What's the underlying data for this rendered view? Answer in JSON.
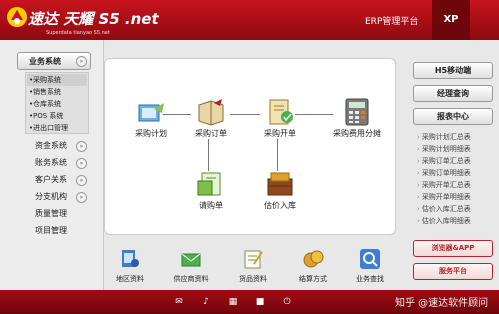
{
  "header": {
    "logo_cn": "速达 天耀 S5 .net",
    "logo_en": "Superdata tianyao S5.net",
    "platform": "ERP管理平台",
    "edition": "XP"
  },
  "left": {
    "section_title": "业务系统",
    "sub_items": [
      "采购系统",
      "销售系统",
      "仓库系统",
      "POS 系统",
      "进出口管理"
    ],
    "categories": [
      "资金系统",
      "账务系统",
      "客户关系",
      "分支机构",
      "质量管理",
      "项目管理"
    ]
  },
  "flow": {
    "nodes": [
      "采购计划",
      "采购订单",
      "采购开单",
      "采购费用分摊",
      "请购单",
      "估价入库"
    ]
  },
  "bottom_nav": [
    "地区资料",
    "供应商资料",
    "货品资料",
    "结算方式",
    "业务查找"
  ],
  "right": {
    "buttons": [
      "H5移动端",
      "经理查询",
      "报表中心"
    ],
    "reports": [
      "采购计划汇总表",
      "采购计划明细表",
      "采购订单汇总表",
      "采购订单明细表",
      "采购开单汇总表",
      "采购开单明细表",
      "估价入库汇总表",
      "估价入库明细表"
    ],
    "browser_app": "浏览器&APP",
    "service": "服务平台"
  },
  "watermark": "知乎 @速达软件顾问",
  "icons": [
    "logo-icon",
    "expand-chevron-icon",
    "plan-icon",
    "order-icon",
    "invoice-icon",
    "calculator-icon",
    "requisition-icon",
    "warehouse-icon",
    "region-icon",
    "supplier-icon",
    "goods-icon",
    "settlement-icon",
    "search-icon",
    "mail-icon",
    "sound-icon",
    "calendar-icon",
    "lock-icon",
    "power-icon"
  ]
}
